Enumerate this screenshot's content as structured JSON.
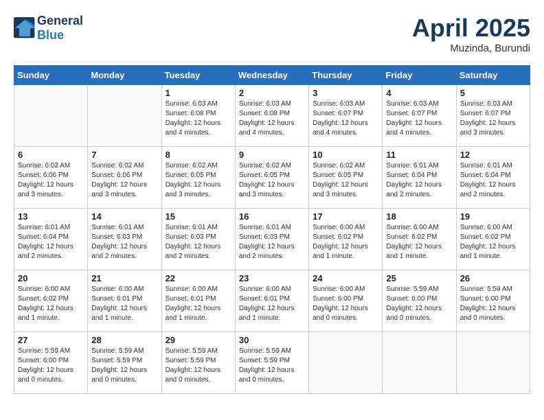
{
  "header": {
    "logo_line1": "General",
    "logo_line2": "Blue",
    "month": "April 2025",
    "location": "Muzinda, Burundi"
  },
  "weekdays": [
    "Sunday",
    "Monday",
    "Tuesday",
    "Wednesday",
    "Thursday",
    "Friday",
    "Saturday"
  ],
  "weeks": [
    [
      {
        "day": "",
        "info": ""
      },
      {
        "day": "",
        "info": ""
      },
      {
        "day": "1",
        "info": "Sunrise: 6:03 AM\nSunset: 6:08 PM\nDaylight: 12 hours and 4 minutes."
      },
      {
        "day": "2",
        "info": "Sunrise: 6:03 AM\nSunset: 6:08 PM\nDaylight: 12 hours and 4 minutes."
      },
      {
        "day": "3",
        "info": "Sunrise: 6:03 AM\nSunset: 6:07 PM\nDaylight: 12 hours and 4 minutes."
      },
      {
        "day": "4",
        "info": "Sunrise: 6:03 AM\nSunset: 6:07 PM\nDaylight: 12 hours and 4 minutes."
      },
      {
        "day": "5",
        "info": "Sunrise: 6:03 AM\nSunset: 6:07 PM\nDaylight: 12 hours and 3 minutes."
      }
    ],
    [
      {
        "day": "6",
        "info": "Sunrise: 6:02 AM\nSunset: 6:06 PM\nDaylight: 12 hours and 3 minutes."
      },
      {
        "day": "7",
        "info": "Sunrise: 6:02 AM\nSunset: 6:06 PM\nDaylight: 12 hours and 3 minutes."
      },
      {
        "day": "8",
        "info": "Sunrise: 6:02 AM\nSunset: 6:05 PM\nDaylight: 12 hours and 3 minutes."
      },
      {
        "day": "9",
        "info": "Sunrise: 6:02 AM\nSunset: 6:05 PM\nDaylight: 12 hours and 3 minutes."
      },
      {
        "day": "10",
        "info": "Sunrise: 6:02 AM\nSunset: 6:05 PM\nDaylight: 12 hours and 3 minutes."
      },
      {
        "day": "11",
        "info": "Sunrise: 6:01 AM\nSunset: 6:04 PM\nDaylight: 12 hours and 2 minutes."
      },
      {
        "day": "12",
        "info": "Sunrise: 6:01 AM\nSunset: 6:04 PM\nDaylight: 12 hours and 2 minutes."
      }
    ],
    [
      {
        "day": "13",
        "info": "Sunrise: 6:01 AM\nSunset: 6:04 PM\nDaylight: 12 hours and 2 minutes."
      },
      {
        "day": "14",
        "info": "Sunrise: 6:01 AM\nSunset: 6:03 PM\nDaylight: 12 hours and 2 minutes."
      },
      {
        "day": "15",
        "info": "Sunrise: 6:01 AM\nSunset: 6:03 PM\nDaylight: 12 hours and 2 minutes."
      },
      {
        "day": "16",
        "info": "Sunrise: 6:01 AM\nSunset: 6:03 PM\nDaylight: 12 hours and 2 minutes."
      },
      {
        "day": "17",
        "info": "Sunrise: 6:00 AM\nSunset: 6:02 PM\nDaylight: 12 hours and 1 minute."
      },
      {
        "day": "18",
        "info": "Sunrise: 6:00 AM\nSunset: 6:02 PM\nDaylight: 12 hours and 1 minute."
      },
      {
        "day": "19",
        "info": "Sunrise: 6:00 AM\nSunset: 6:02 PM\nDaylight: 12 hours and 1 minute."
      }
    ],
    [
      {
        "day": "20",
        "info": "Sunrise: 6:00 AM\nSunset: 6:02 PM\nDaylight: 12 hours and 1 minute."
      },
      {
        "day": "21",
        "info": "Sunrise: 6:00 AM\nSunset: 6:01 PM\nDaylight: 12 hours and 1 minute."
      },
      {
        "day": "22",
        "info": "Sunrise: 6:00 AM\nSunset: 6:01 PM\nDaylight: 12 hours and 1 minute."
      },
      {
        "day": "23",
        "info": "Sunrise: 6:00 AM\nSunset: 6:01 PM\nDaylight: 12 hours and 1 minute."
      },
      {
        "day": "24",
        "info": "Sunrise: 6:00 AM\nSunset: 6:00 PM\nDaylight: 12 hours and 0 minutes."
      },
      {
        "day": "25",
        "info": "Sunrise: 5:59 AM\nSunset: 6:00 PM\nDaylight: 12 hours and 0 minutes."
      },
      {
        "day": "26",
        "info": "Sunrise: 5:59 AM\nSunset: 6:00 PM\nDaylight: 12 hours and 0 minutes."
      }
    ],
    [
      {
        "day": "27",
        "info": "Sunrise: 5:59 AM\nSunset: 6:00 PM\nDaylight: 12 hours and 0 minutes."
      },
      {
        "day": "28",
        "info": "Sunrise: 5:59 AM\nSunset: 5:59 PM\nDaylight: 12 hours and 0 minutes."
      },
      {
        "day": "29",
        "info": "Sunrise: 5:59 AM\nSunset: 5:59 PM\nDaylight: 12 hours and 0 minutes."
      },
      {
        "day": "30",
        "info": "Sunrise: 5:59 AM\nSunset: 5:59 PM\nDaylight: 12 hours and 0 minutes."
      },
      {
        "day": "",
        "info": ""
      },
      {
        "day": "",
        "info": ""
      },
      {
        "day": "",
        "info": ""
      }
    ]
  ]
}
